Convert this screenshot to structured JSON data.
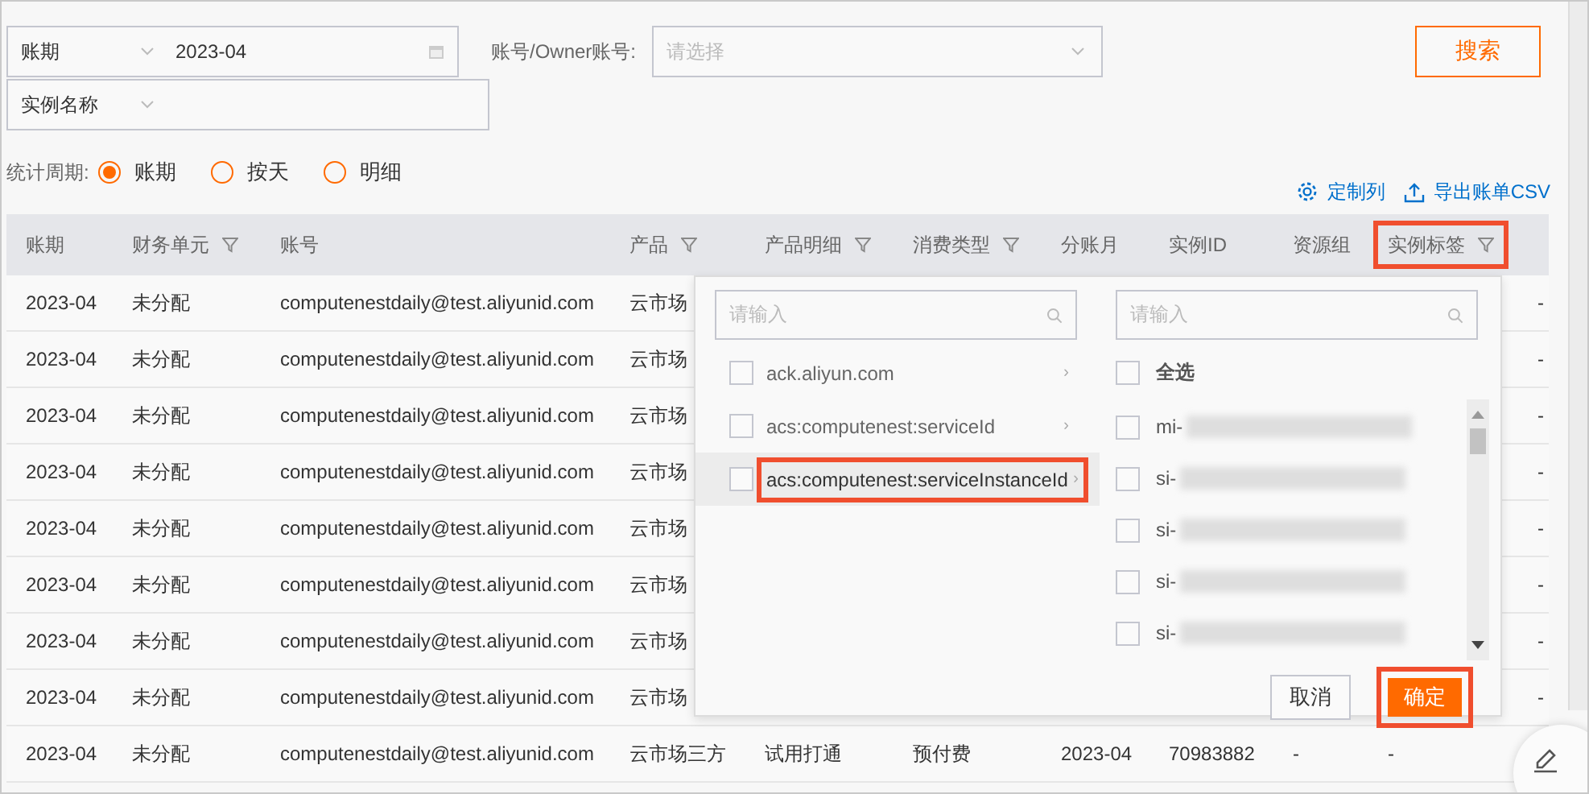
{
  "filters": {
    "period_type": {
      "value": "账期"
    },
    "period": {
      "value": "2023-04"
    },
    "account": {
      "label": "账号/Owner账号:",
      "placeholder": "请选择"
    },
    "instance": {
      "value": "实例名称"
    },
    "search_button": "搜索"
  },
  "stat_period": {
    "label": "统计周期:",
    "options": [
      {
        "label": "账期",
        "selected": true
      },
      {
        "label": "按天",
        "selected": false
      },
      {
        "label": "明细",
        "selected": false
      }
    ]
  },
  "actions": [
    {
      "kind": "settings",
      "label": "定制列"
    },
    {
      "kind": "export",
      "label": "导出账单CSV"
    }
  ],
  "table": {
    "columns": [
      {
        "label": "账期",
        "filter": false,
        "highlighted": false
      },
      {
        "label": "财务单元",
        "filter": true,
        "highlighted": false
      },
      {
        "label": "账号",
        "filter": false,
        "highlighted": false
      },
      {
        "label": "产品",
        "filter": true,
        "highlighted": false
      },
      {
        "label": "产品明细",
        "filter": true,
        "highlighted": false
      },
      {
        "label": "消费类型",
        "filter": true,
        "highlighted": false
      },
      {
        "label": "分账月",
        "filter": false,
        "highlighted": false
      },
      {
        "label": "实例ID",
        "filter": false,
        "highlighted": false
      },
      {
        "label": "资源组",
        "filter": false,
        "highlighted": false
      },
      {
        "label": "实例标签",
        "filter": true,
        "highlighted": true
      }
    ],
    "rows": [
      {
        "cells": [
          "2023-04",
          "未分配",
          "computenestdaily@test.aliyunid.com",
          "云市场",
          null,
          null,
          null,
          null,
          null,
          null,
          "-"
        ]
      },
      {
        "cells": [
          "2023-04",
          "未分配",
          "computenestdaily@test.aliyunid.com",
          "云市场",
          null,
          null,
          null,
          null,
          null,
          null,
          "-"
        ]
      },
      {
        "cells": [
          "2023-04",
          "未分配",
          "computenestdaily@test.aliyunid.com",
          "云市场",
          null,
          null,
          null,
          null,
          null,
          null,
          "-"
        ]
      },
      {
        "cells": [
          "2023-04",
          "未分配",
          "computenestdaily@test.aliyunid.com",
          "云市场",
          null,
          null,
          null,
          null,
          null,
          null,
          "-"
        ]
      },
      {
        "cells": [
          "2023-04",
          "未分配",
          "computenestdaily@test.aliyunid.com",
          "云市场",
          null,
          null,
          null,
          null,
          null,
          null,
          "-"
        ]
      },
      {
        "cells": [
          "2023-04",
          "未分配",
          "computenestdaily@test.aliyunid.com",
          "云市场",
          null,
          null,
          null,
          null,
          null,
          null,
          "-"
        ]
      },
      {
        "cells": [
          "2023-04",
          "未分配",
          "computenestdaily@test.aliyunid.com",
          "云市场",
          null,
          null,
          null,
          null,
          null,
          null,
          "-"
        ]
      },
      {
        "cells": [
          "2023-04",
          "未分配",
          "computenestdaily@test.aliyunid.com",
          "云市场",
          null,
          null,
          null,
          null,
          null,
          null,
          "-"
        ]
      },
      {
        "cells": [
          "2023-04",
          "未分配",
          "computenestdaily@test.aliyunid.com",
          "云市场三方",
          "试用打通",
          "预付费",
          "2023-04",
          "70983882",
          "-",
          "-",
          null
        ]
      }
    ]
  },
  "tag_popup": {
    "key_search": {
      "placeholder": "请输入"
    },
    "keys": [
      {
        "label": "ack.aliyun.com",
        "arrow": "›",
        "checked": false,
        "selected": false,
        "highlighted": false
      },
      {
        "label": "acs:computenest:serviceId",
        "arrow": "›",
        "checked": false,
        "selected": false,
        "highlighted": false
      },
      {
        "label": "acs:computenest:serviceInstanceId",
        "arrow": "›",
        "checked": false,
        "selected": true,
        "highlighted": true
      }
    ],
    "value_search": {
      "placeholder": "请输入"
    },
    "select_all": {
      "label": "全选",
      "checked": false
    },
    "values": [
      {
        "label": "mi-",
        "checked": false,
        "redacted": true
      },
      {
        "label": "si-",
        "checked": false,
        "redacted": true
      },
      {
        "label": "si-",
        "checked": false,
        "redacted": true
      },
      {
        "label": "si-",
        "checked": false,
        "redacted": true
      },
      {
        "label": "si-",
        "checked": false,
        "redacted": true
      }
    ],
    "cancel_button": "取消",
    "confirm_button": {
      "label": "确定",
      "highlighted": true
    }
  }
}
